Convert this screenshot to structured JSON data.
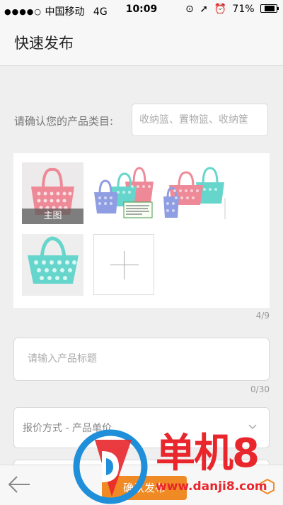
{
  "status_bar": {
    "carrier": "中国移动",
    "network": "4G",
    "time": "10:09",
    "battery": "71%",
    "battery_level": 0.71
  },
  "header": {
    "title": "快速发布"
  },
  "category": {
    "label": "请确认您的产品类目:",
    "value": "收纳篮、置物篮、收纳筐"
  },
  "images": {
    "main_tag": "主图",
    "count": "4/9",
    "add_icon": "plus-icon"
  },
  "product_title": {
    "placeholder": "请输入产品标题",
    "count": "0/30"
  },
  "price": {
    "label": "报价方式 - 产品单价",
    "icon": "chevron-down-icon"
  },
  "bottom_bar": {
    "back_icon": "back-arrow-icon",
    "confirm_label": "确认发布"
  },
  "watermark": {
    "text": "单机8",
    "url": "www.danji8.com"
  },
  "colors": {
    "accent": "#f08a24",
    "basket_pink": "#ee8a97",
    "basket_teal": "#66d6cc",
    "basket_blue": "#8f9de2",
    "watermark_red": "#e8262c",
    "watermark_blue": "#1f8fd9"
  }
}
